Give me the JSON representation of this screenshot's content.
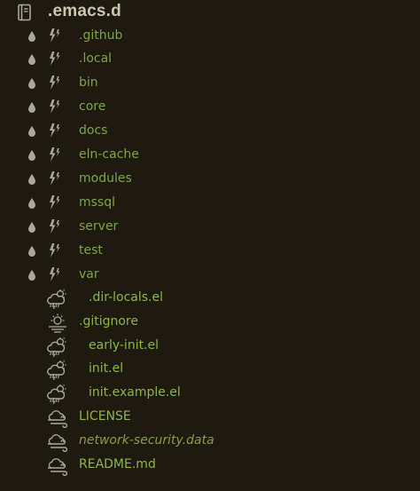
{
  "root": {
    "label": ".emacs.d",
    "icon": "book-icon"
  },
  "folders": [
    {
      "label": ".github",
      "icon": "bolt-icon"
    },
    {
      "label": ".local",
      "icon": "bolt-icon"
    },
    {
      "label": "bin",
      "icon": "bolt-icon"
    },
    {
      "label": "core",
      "icon": "bolt-icon"
    },
    {
      "label": "docs",
      "icon": "bolt-icon"
    },
    {
      "label": "eln-cache",
      "icon": "bolt-icon"
    },
    {
      "label": "modules",
      "icon": "bolt-icon"
    },
    {
      "label": "mssql",
      "icon": "bolt-icon"
    },
    {
      "label": "server",
      "icon": "bolt-icon"
    },
    {
      "label": "test",
      "icon": "bolt-icon"
    },
    {
      "label": "var",
      "icon": "bolt-icon"
    }
  ],
  "files": [
    {
      "label": ".dir-locals.el",
      "icon": "storm-cloud-icon",
      "kind": "el"
    },
    {
      "label": ".gitignore",
      "icon": "sun-cloud-icon",
      "kind": "git"
    },
    {
      "label": "early-init.el",
      "icon": "storm-cloud-icon",
      "kind": "el"
    },
    {
      "label": "init.el",
      "icon": "storm-cloud-icon",
      "kind": "el"
    },
    {
      "label": "init.example.el",
      "icon": "storm-cloud-icon",
      "kind": "el"
    },
    {
      "label": "LICENSE",
      "icon": "wind-cloud-icon",
      "kind": "plain"
    },
    {
      "label": "network-security.data",
      "icon": "wind-cloud-icon",
      "kind": "italic"
    },
    {
      "label": "README.md",
      "icon": "wind-cloud-icon",
      "kind": "md"
    }
  ],
  "colors": {
    "background": "#1f1a10",
    "folder_text": "#7fa63c",
    "file_text": "#8ab83e",
    "icon": "#a8a8a0",
    "root_text": "#c8c8b0"
  }
}
